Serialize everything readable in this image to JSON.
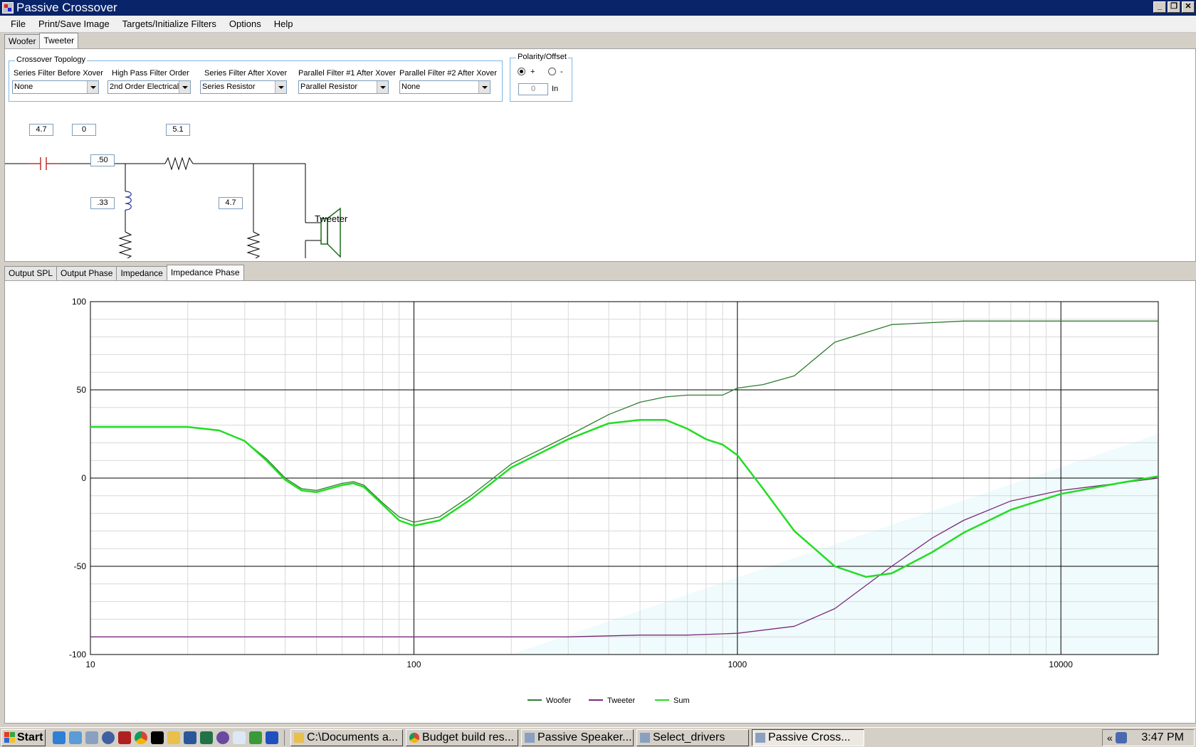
{
  "window": {
    "title": "Passive Crossover"
  },
  "menu": [
    "File",
    "Print/Save Image",
    "Targets/Initialize Filters",
    "Options",
    "Help"
  ],
  "driver_tabs": [
    "Woofer",
    "Tweeter"
  ],
  "driver_tab_active": "Tweeter",
  "topology": {
    "group_label": "Crossover Topology",
    "fields": [
      {
        "label": "Series Filter Before Xover",
        "value": "None"
      },
      {
        "label": "High Pass Filter Order",
        "value": "2nd Order Electrical"
      },
      {
        "label": "Series Filter After Xover",
        "value": "Series Resistor"
      },
      {
        "label": "Parallel Filter #1 After Xover",
        "value": "Parallel Resistor"
      },
      {
        "label": "Parallel Filter #2 After Xover",
        "value": "None"
      }
    ]
  },
  "polarity": {
    "group_label": "Polarity/Offset",
    "plus": "+",
    "minus": "-",
    "selected": "+",
    "offset_value": "0",
    "offset_unit": "In"
  },
  "schematic": {
    "cap_value": "4.7",
    "cap_extra": "0",
    "series_res": "5.1",
    "inductor": ".50",
    "inductor_res": ".33",
    "parallel_res": "4.7",
    "driver_label": "Tweeter"
  },
  "graph_tabs": [
    "Output SPL",
    "Output Phase",
    "Impedance",
    "Impedance Phase"
  ],
  "graph_tab_active": "Impedance Phase",
  "chart_data": {
    "type": "line",
    "x_scale": "log",
    "xlim": [
      10,
      20000
    ],
    "ylim": [
      -100,
      100
    ],
    "x_ticks": [
      10,
      100,
      1000,
      10000
    ],
    "y_ticks": [
      100,
      50,
      0,
      -50,
      -100
    ],
    "grid": true,
    "legend_position": "bottom-center",
    "series": [
      {
        "name": "Woofer",
        "color": "#2e7d2e",
        "x": [
          10,
          20,
          25,
          30,
          35,
          40,
          45,
          50,
          60,
          65,
          70,
          80,
          90,
          100,
          120,
          150,
          200,
          300,
          400,
          500,
          600,
          700,
          800,
          900,
          1000,
          1200,
          1500,
          2000,
          3000,
          5000,
          10000,
          20000
        ],
        "y": [
          29,
          29,
          27,
          21,
          11,
          0,
          -6,
          -7,
          -3,
          -2,
          -4,
          -14,
          -22,
          -25,
          -22,
          -10,
          8,
          24,
          36,
          43,
          46,
          47,
          47,
          47,
          51,
          53,
          58,
          77,
          87,
          89,
          89,
          89
        ]
      },
      {
        "name": "Tweeter",
        "color": "#7a2a7a",
        "x": [
          10,
          100,
          300,
          500,
          700,
          1000,
          1500,
          2000,
          3000,
          4000,
          5000,
          7000,
          10000,
          15000,
          20000
        ],
        "y": [
          -90,
          -90,
          -90,
          -89,
          -89,
          -88,
          -84,
          -74,
          -50,
          -34,
          -24,
          -13,
          -7,
          -3,
          0
        ]
      },
      {
        "name": "Sum",
        "color": "#22dd22",
        "x": [
          10,
          20,
          25,
          30,
          35,
          40,
          45,
          50,
          60,
          65,
          70,
          80,
          90,
          100,
          120,
          150,
          200,
          300,
          400,
          500,
          600,
          700,
          800,
          900,
          1000,
          1200,
          1500,
          2000,
          2500,
          3000,
          4000,
          5000,
          7000,
          10000,
          15000,
          20000
        ],
        "y": [
          29,
          29,
          27,
          21,
          10,
          -1,
          -7,
          -8,
          -4,
          -3,
          -5,
          -15,
          -24,
          -27,
          -24,
          -12,
          6,
          22,
          31,
          33,
          33,
          28,
          22,
          19,
          13,
          -6,
          -30,
          -50,
          -56,
          -54,
          -42,
          -31,
          -18,
          -9,
          -3,
          1
        ]
      }
    ]
  },
  "taskbar": {
    "start_label": "Start",
    "buttons": [
      "C:\\Documents a...",
      "Budget build res...",
      "Passive Speaker...",
      "Select_drivers",
      "Passive Cross..."
    ],
    "active_button": "Passive Cross...",
    "tray_arrow": "«",
    "clock": "3:47 PM"
  }
}
